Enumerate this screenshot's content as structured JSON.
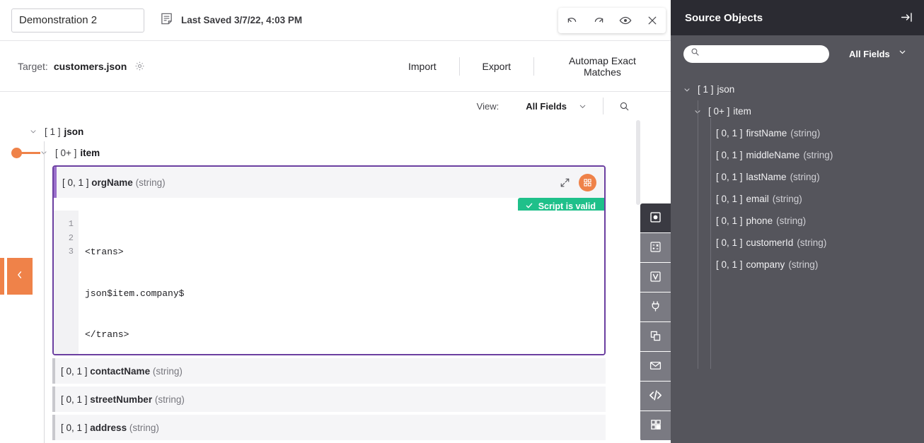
{
  "topbar": {
    "title_value": "Demonstration 2",
    "title_placeholder": "Untitled",
    "note_icon": "note-icon",
    "last_saved": "Last Saved 3/7/22, 4:03 PM",
    "buttons": [
      {
        "name": "undo-button",
        "icon": "undo-icon"
      },
      {
        "name": "redo-button",
        "icon": "redo-icon"
      },
      {
        "name": "preview-button",
        "icon": "eye-icon"
      },
      {
        "name": "close-button",
        "icon": "close-icon"
      }
    ]
  },
  "target": {
    "label": "Target:",
    "name": "customers.json",
    "gear_icon": "gear-icon",
    "actions": [
      "Import",
      "Export",
      "Automap Exact Matches"
    ]
  },
  "view": {
    "label": "View:",
    "value": "All Fields",
    "chevron_icon": "chevron-down-icon",
    "search_icon": "search-icon"
  },
  "tree": {
    "root": {
      "bracket": "[ 1 ]",
      "name": "json"
    },
    "item": {
      "bracket": "[ 0+ ]",
      "name": "item"
    }
  },
  "mapping_card": {
    "bracket": "[ 0, 1 ]",
    "field": "orgName",
    "type": "(string)",
    "expand_icon": "expand-arrows-icon",
    "action_icon": "grid-squares-icon",
    "badge": "Script is valid",
    "badge_icon": "check-icon",
    "badge_color": "#1fc08a",
    "border_color": "#6b3fa0",
    "code_lines": [
      "<trans>",
      "json$item.company$",
      "</trans>"
    ],
    "line_numbers": [
      "1",
      "2",
      "3"
    ]
  },
  "fields": [
    {
      "bracket": "[ 0, 1 ]",
      "name": "contactName",
      "type": "(string)"
    },
    {
      "bracket": "[ 0, 1 ]",
      "name": "streetNumber",
      "type": "(string)"
    },
    {
      "bracket": "[ 0, 1 ]",
      "name": "address",
      "type": "(string)"
    }
  ],
  "rail": [
    {
      "name": "rail-mapping",
      "icon": "square-dot-icon",
      "active": true
    },
    {
      "name": "rail-expression",
      "icon": "calculator-icon",
      "active": false
    },
    {
      "name": "rail-variable",
      "icon": "variable-v-icon",
      "active": false
    },
    {
      "name": "rail-connector",
      "icon": "plug-icon",
      "active": false
    },
    {
      "name": "rail-duplicate",
      "icon": "copy-icon",
      "active": false
    },
    {
      "name": "rail-email",
      "icon": "envelope-icon",
      "active": false
    },
    {
      "name": "rail-code",
      "icon": "code-brackets-icon",
      "active": false
    },
    {
      "name": "rail-apps",
      "icon": "grid-apps-icon",
      "active": false
    }
  ],
  "left_handle": {
    "icon": "chevron-left-icon",
    "color": "#ef8249"
  },
  "sidebar": {
    "title": "Source Objects",
    "collapse_icon": "collapse-right-icon",
    "search_value": "",
    "search_placeholder": "",
    "search_icon": "search-icon",
    "filter_label": "All Fields",
    "filter_icon": "chevron-down-icon",
    "tree": {
      "root": {
        "bracket": "[ 1 ]",
        "name": "json"
      },
      "item": {
        "bracket": "[ 0+ ]",
        "name": "item"
      },
      "fields": [
        {
          "bracket": "[ 0, 1 ]",
          "name": "firstName",
          "type": "(string)"
        },
        {
          "bracket": "[ 0, 1 ]",
          "name": "middleName",
          "type": "(string)"
        },
        {
          "bracket": "[ 0, 1 ]",
          "name": "lastName",
          "type": "(string)"
        },
        {
          "bracket": "[ 0, 1 ]",
          "name": "email",
          "type": "(string)"
        },
        {
          "bracket": "[ 0, 1 ]",
          "name": "phone",
          "type": "(string)"
        },
        {
          "bracket": "[ 0, 1 ]",
          "name": "customerId",
          "type": "(string)"
        },
        {
          "bracket": "[ 0, 1 ]",
          "name": "company",
          "type": "(string)"
        }
      ]
    }
  }
}
